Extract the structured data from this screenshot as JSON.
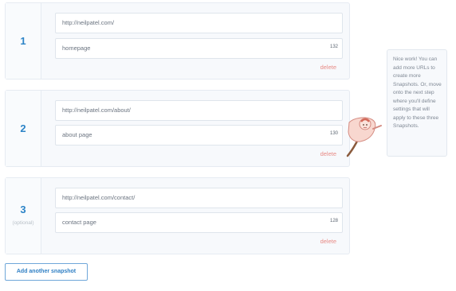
{
  "snapshots": [
    {
      "number": "1",
      "url": "http://neilpatel.com/",
      "label": "homepage",
      "char_count": "132",
      "delete_label": "delete",
      "optional_label": ""
    },
    {
      "number": "2",
      "url": "http://neilpatel.com/about/",
      "label": "about page",
      "char_count": "130",
      "delete_label": "delete",
      "optional_label": ""
    },
    {
      "number": "3",
      "url": "http://neilpatel.com/contact/",
      "label": "contact page",
      "char_count": "128",
      "delete_label": "delete",
      "optional_label": "(optional)"
    }
  ],
  "tooltip": {
    "text": "Nice work! You can add more URLs to create more Snapshots. Or, move onto the next step where you'll define settings that will apply to these three Snapshots."
  },
  "add_button": {
    "label": "Add another snapshot"
  },
  "icons": {
    "mascot": "pointing-mascot-icon"
  },
  "colors": {
    "accent": "#2d84c7",
    "delete": "#e88b86",
    "border": "#e6ebf2",
    "button_border": "#6fa7d9"
  }
}
